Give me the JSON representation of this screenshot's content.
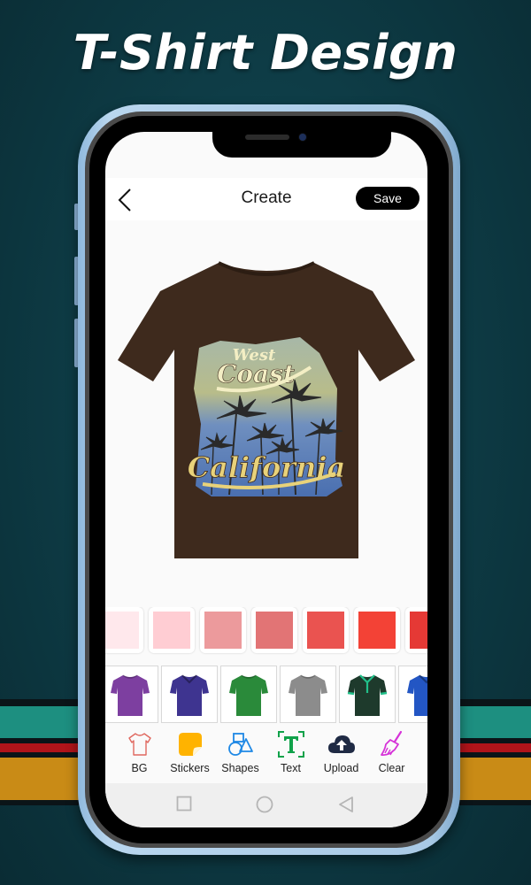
{
  "headline": "T-Shirt Design",
  "header": {
    "title": "Create",
    "save_label": "Save"
  },
  "design": {
    "shirt_color": "#3e2a1d",
    "line1": "West",
    "line2": "Coast",
    "line3": "California"
  },
  "color_swatches": [
    "#ffe8ec",
    "#ffcdd3",
    "#ec9a9c",
    "#e27475",
    "#ea5350",
    "#f34236",
    "#e53935"
  ],
  "shirt_options": [
    {
      "name": "purple-tshirt",
      "color": "#7d3fa0",
      "collar": "crew"
    },
    {
      "name": "indigo-polo",
      "color": "#3e3490",
      "collar": "polo"
    },
    {
      "name": "green-tshirt",
      "color": "#2a8a3a",
      "collar": "crew"
    },
    {
      "name": "gray-tshirt",
      "color": "#8c8c8c",
      "collar": "crew"
    },
    {
      "name": "darkgreen-polo",
      "color": "#1e3a2c",
      "collar": "polo-accent"
    },
    {
      "name": "blue-polo",
      "color": "#2356c4",
      "collar": "polo"
    }
  ],
  "toolbar": {
    "items": [
      {
        "label": "BG",
        "icon": "tshirt-outline-icon"
      },
      {
        "label": "Stickers",
        "icon": "sticker-icon"
      },
      {
        "label": "Shapes",
        "icon": "shapes-icon"
      },
      {
        "label": "Text",
        "icon": "text-icon"
      },
      {
        "label": "Upload",
        "icon": "cloud-upload-icon"
      },
      {
        "label": "Clear",
        "icon": "broom-icon"
      }
    ]
  },
  "colors": {
    "bg_icon": "#e0685f",
    "sticker": "#ffb300",
    "shapes": "#1e88e5",
    "text": "#10a24a",
    "upload": "#1f2a44",
    "clear": "#d633d8"
  }
}
